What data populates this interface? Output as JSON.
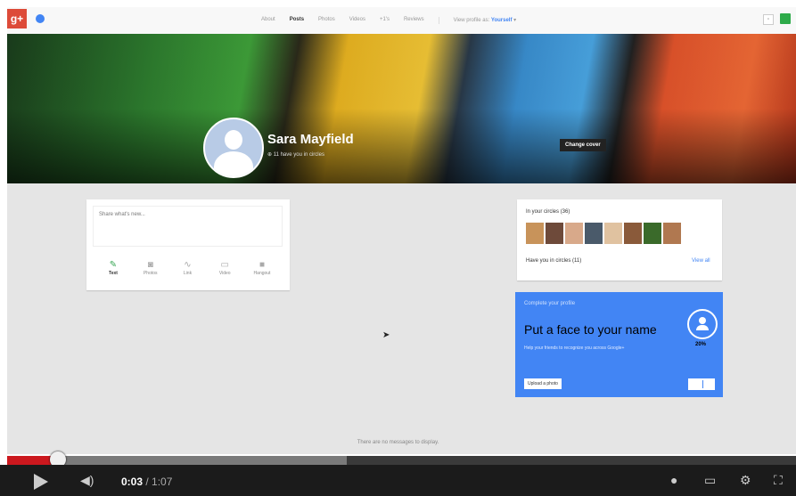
{
  "topbar": {
    "logo": "g+",
    "tabs": [
      "About",
      "Posts",
      "Photos",
      "Videos",
      "+1's",
      "Reviews"
    ],
    "active_tab": "Posts",
    "view_as_label": "View profile as:",
    "view_as_value": "Yourself"
  },
  "profile": {
    "name": "Sara Mayfield",
    "circles_line": "11 have you in circles",
    "change_cover": "Change cover"
  },
  "share": {
    "placeholder": "Share what's new...",
    "actions": [
      {
        "label": "Text",
        "icon": "pencil-icon"
      },
      {
        "label": "Photos",
        "icon": "camera-icon"
      },
      {
        "label": "Link",
        "icon": "link-icon"
      },
      {
        "label": "Video",
        "icon": "video-icon"
      },
      {
        "label": "Hangout",
        "icon": "hangout-icon"
      }
    ]
  },
  "circles": {
    "title": "In your circles (36)",
    "have_you": "Have you in circles (11)",
    "view_all": "View all",
    "face_colors": [
      "#c8935a",
      "#6e4a3a",
      "#d8a98a",
      "#4a5a6a",
      "#e0c2a0",
      "#8a5a3a",
      "#3a6a2a",
      "#b07850"
    ]
  },
  "complete": {
    "top": "Complete your profile",
    "title": "Put a face to your name",
    "subtitle": "Help your friends to recognize you across Google+",
    "percent": "20%",
    "upload": "Upload a photo"
  },
  "messages": {
    "empty": "There are no messages to display."
  },
  "player": {
    "current": "0:03",
    "duration": "1:07",
    "played_fraction": 0.055,
    "loaded_fraction": 0.43
  }
}
